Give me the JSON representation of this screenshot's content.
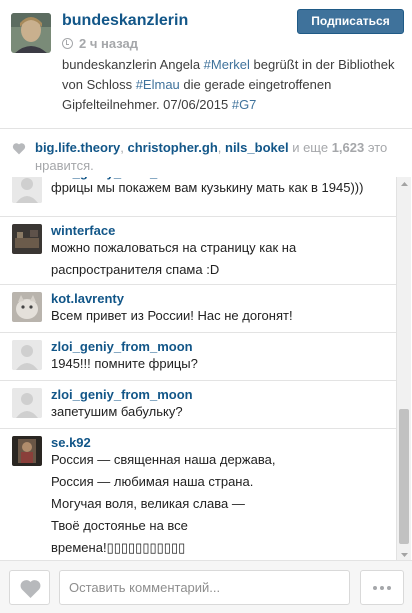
{
  "post": {
    "username": "bundeskanzlerin",
    "time": "2 ч назад",
    "follow_label": "Подписаться",
    "caption": {
      "part1": "bundeskanzlerin Angela ",
      "tag1": "#Merkel",
      "part2": " begrüßt in der Bibliothek von Schloss ",
      "tag2": "#Elmau",
      "part3": " die gerade eingetroffenen Gipfelteilnehmer. 07/06/2015 ",
      "tag3": "#G7"
    }
  },
  "likes": {
    "likers": [
      "big.life.theory",
      "christopher.gh",
      "nils_bokel"
    ],
    "sep": ", ",
    "and_more": " и еще ",
    "count": "1,623",
    "suffix": " это нравится."
  },
  "comments": [
    {
      "user": "zloi_geniy_from_moon",
      "text": "фрицы мы покажем вам кузькину мать как в 1945)))",
      "avatar": "placeholder"
    },
    {
      "user": "winterface",
      "text": "можно пожаловаться на страницу как на\nраспространителя спама :D",
      "avatar": "photo-dark"
    },
    {
      "user": "kot.lavrenty",
      "text": "Всем привет из России! Нас не догонят!",
      "avatar": "photo-cat"
    },
    {
      "user": "zloi_geniy_from_moon",
      "text": "1945!!! помните фрицы?",
      "avatar": "placeholder"
    },
    {
      "user": "zloi_geniy_from_moon",
      "text": "запетушим бабульку?",
      "avatar": "placeholder"
    },
    {
      "user": "se.k92",
      "text": "Россия — священная наша держава,\nРоссия — любимая наша страна.\nМогучая воля, великая слава —\nТвоё достоянье на все\nвремена!",
      "tofu": "▯▯▯▯▯▯▯▯▯▯▯",
      "avatar": "photo-dark2"
    }
  ],
  "footer": {
    "comment_placeholder": "Оставить комментарий..."
  },
  "colors": {
    "link": "#125688",
    "hashtag": "#3f729b",
    "follow_bg": "#3f729b",
    "muted": "#a5a7aa"
  },
  "icons": [
    "clock-icon",
    "heart-icon",
    "more-icon",
    "scroll-up-icon",
    "scroll-down-icon"
  ]
}
